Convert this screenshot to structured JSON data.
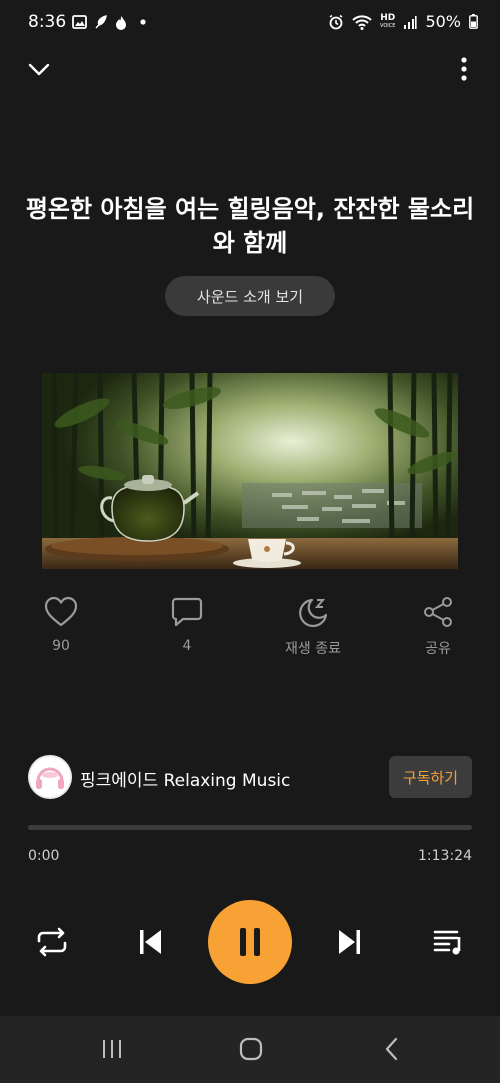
{
  "status_bar": {
    "time": "8:36",
    "left_icons": [
      "image-icon",
      "feather-icon",
      "flame-icon",
      "dot-icon"
    ],
    "right_icons": [
      "alarm-icon",
      "wifi-icon",
      "hd-voice-icon",
      "signal-icon",
      "battery-icon"
    ],
    "hd_label": "HD",
    "voice_label": "VOICE",
    "battery": "50%"
  },
  "track": {
    "title": "평온한 아침을 여는 힐링음악, 잔잔한 물소리와 함께",
    "intro_button": "사운드 소개 보기"
  },
  "actions": {
    "like": {
      "icon": "heart-icon",
      "label": "90"
    },
    "comment": {
      "icon": "comment-icon",
      "label": "4"
    },
    "sleep": {
      "icon": "moon-icon",
      "label": "재생 종료"
    },
    "share": {
      "icon": "share-icon",
      "label": "공유"
    }
  },
  "channel": {
    "name": "핑크에이드 Relaxing Music",
    "subscribe": "구독하기"
  },
  "progress": {
    "current": "0:00",
    "total": "1:13:24",
    "fraction": 0
  },
  "controls": [
    "repeat-icon",
    "previous-icon",
    "pause-icon",
    "next-icon",
    "playlist-icon"
  ],
  "colors": {
    "accent": "#f8a236",
    "background": "#191919"
  }
}
